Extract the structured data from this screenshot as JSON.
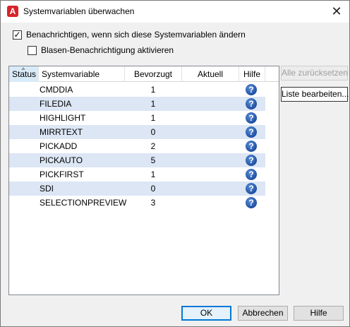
{
  "window": {
    "title": "Systemvariablen überwachen",
    "app_icon_letter": "A",
    "close_glyph": "✕"
  },
  "options": {
    "notify_label": "Benachrichtigen, wenn sich diese Systemvariablen ändern",
    "notify_checked": true,
    "balloon_label": "Blasen-Benachrichtigung aktivieren",
    "balloon_checked": false
  },
  "table": {
    "columns": {
      "status": "Status",
      "sysvar": "Systemvariable",
      "preferred": "Bevorzugt",
      "current": "Aktuell",
      "help": "Hilfe"
    },
    "help_glyph": "?",
    "rows": [
      {
        "name": "CMDDIA",
        "preferred": "1",
        "current": ""
      },
      {
        "name": "FILEDIA",
        "preferred": "1",
        "current": ""
      },
      {
        "name": "HIGHLIGHT",
        "preferred": "1",
        "current": ""
      },
      {
        "name": "MIRRTEXT",
        "preferred": "0",
        "current": ""
      },
      {
        "name": "PICKADD",
        "preferred": "2",
        "current": ""
      },
      {
        "name": "PICKAUTO",
        "preferred": "5",
        "current": ""
      },
      {
        "name": "PICKFIRST",
        "preferred": "1",
        "current": ""
      },
      {
        "name": "SDI",
        "preferred": "0",
        "current": ""
      },
      {
        "name": "SELECTIONPREVIEW",
        "preferred": "3",
        "current": ""
      }
    ]
  },
  "buttons": {
    "reset_all": "Alle zurücksetzen",
    "edit_list": "Liste bearbeiten...",
    "ok": "OK",
    "cancel": "Abbrechen",
    "help": "Hilfe"
  },
  "colors": {
    "row_alt": "#dce6f4",
    "app_icon": "#d8232a",
    "help_icon": "#1f4fa3",
    "default_button_border": "#0078d7"
  }
}
